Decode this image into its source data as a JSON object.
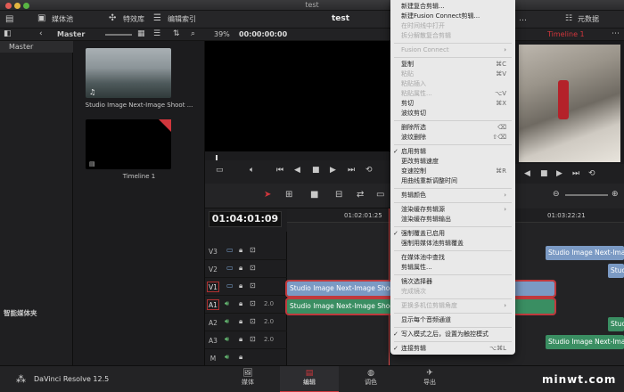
{
  "window": {
    "title": "test"
  },
  "header": {
    "app_title": "test",
    "media_pool": "媒体池",
    "effects": "特效库",
    "edit_index": "编辑索引",
    "metadata": "元数据"
  },
  "subbar": {
    "master": "Master",
    "zoom": "39%",
    "timecode": "00:00:00:00",
    "timeline_name": "Timeline 1"
  },
  "sidebar": {
    "master": "Master",
    "smart_bins": "智能媒体夹"
  },
  "pool": {
    "items": [
      {
        "label": "Studio Image Next-Image Shoot ..."
      },
      {
        "label": "Timeline 1"
      }
    ]
  },
  "timeline": {
    "current_tc": "01:04:01:09",
    "ruler": [
      "01:02:01:25",
      "01:03:22:21"
    ],
    "tracks": [
      {
        "id": "V3"
      },
      {
        "id": "V2"
      },
      {
        "id": "V1",
        "active": true
      },
      {
        "id": "A1",
        "active": true,
        "vol": "2.0"
      },
      {
        "id": "A2",
        "vol": "2.0"
      },
      {
        "id": "A3",
        "vol": "2.0"
      },
      {
        "id": "M"
      }
    ],
    "clips": {
      "v1": "Studio Image Next-Image Shoot at t",
      "a1": "Studio Image Next-Image Shoot at t",
      "v3r": "Studio Image Next-Image...",
      "v2r": "Studio Image...",
      "a2r": "Studio Image...",
      "a3r": "Studio Image Next-Image..."
    }
  },
  "menu": {
    "items": [
      {
        "label": "新建复合剪辑...",
        "dis": false
      },
      {
        "label": "新建Fusion Connect剪辑...",
        "dis": false
      },
      {
        "label": "在时间线中打开",
        "dis": true
      },
      {
        "label": "拆分解散复合剪辑",
        "dis": true
      },
      {
        "sep": true
      },
      {
        "label": "Fusion Connect",
        "dis": true,
        "sub": true
      },
      {
        "sep": true
      },
      {
        "label": "复制",
        "key": "⌘C"
      },
      {
        "label": "粘贴",
        "key": "⌘V",
        "dis": true
      },
      {
        "label": "粘贴插入",
        "dis": true
      },
      {
        "label": "粘贴属性...",
        "key": "⌥V",
        "dis": true
      },
      {
        "label": "剪切",
        "key": "⌘X"
      },
      {
        "label": "波纹剪切"
      },
      {
        "sep": true
      },
      {
        "label": "删除所选",
        "key": "⌫"
      },
      {
        "label": "波纹删除",
        "key": "⇧⌫"
      },
      {
        "sep": true
      },
      {
        "label": "启用剪辑",
        "check": true
      },
      {
        "label": "更改剪辑速度"
      },
      {
        "label": "变速控制",
        "key": "⌘R"
      },
      {
        "label": "用曲线重新调整时间"
      },
      {
        "sep": true
      },
      {
        "label": "剪辑颜色",
        "sub": true
      },
      {
        "sep": true
      },
      {
        "label": "渲染缓存剪辑源",
        "sub": true
      },
      {
        "label": "渲染缓存剪辑输出"
      },
      {
        "sep": true
      },
      {
        "label": "强制覆盖已启用",
        "check": true
      },
      {
        "label": "强制用媒体池剪辑覆盖"
      },
      {
        "sep": true
      },
      {
        "label": "在媒体池中查找"
      },
      {
        "label": "剪辑属性..."
      },
      {
        "sep": true
      },
      {
        "label": "镜次选择器"
      },
      {
        "label": "完成镜次",
        "dis": true
      },
      {
        "sep": true
      },
      {
        "label": "更换多机位剪辑角度",
        "dis": true,
        "sub": true
      },
      {
        "sep": true
      },
      {
        "label": "显示每个音频通道"
      },
      {
        "sep": true
      },
      {
        "label": "写入模式之后，设置为触控模式",
        "check": true
      },
      {
        "sep": true
      },
      {
        "label": "连接剪辑",
        "key": "⌥⌘L",
        "check": true
      }
    ]
  },
  "bottom": {
    "app": "DaVinci Resolve 12.5",
    "tabs": [
      "媒体",
      "编辑",
      "调色",
      "导出"
    ],
    "active_tab": 1,
    "watermark": "minwt.com"
  },
  "colors": {
    "accent": "#d1363c",
    "video_clip": "#7b9ac4",
    "audio_clip": "#3a8e62"
  }
}
